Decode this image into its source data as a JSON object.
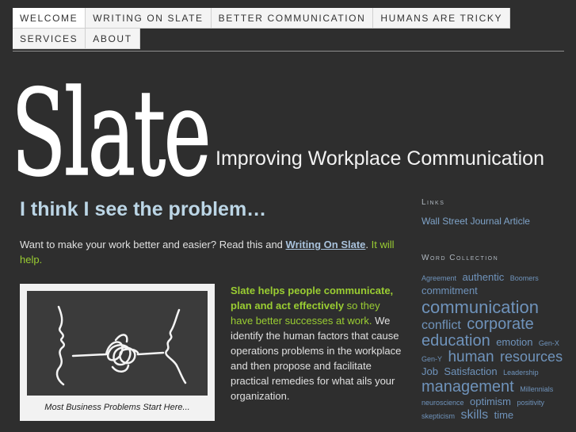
{
  "nav": {
    "items": [
      {
        "label": "WELCOME",
        "name": "nav-welcome"
      },
      {
        "label": "WRITING ON SLATE",
        "name": "nav-writing-on-slate"
      },
      {
        "label": "BETTER COMMUNICATION",
        "name": "nav-better-communication"
      },
      {
        "label": "HUMANS ARE TRICKY",
        "name": "nav-humans-are-tricky"
      },
      {
        "label": "SERVICES",
        "name": "nav-services"
      },
      {
        "label": "ABOUT",
        "name": "nav-about"
      }
    ],
    "active": "WELCOME"
  },
  "header": {
    "logo_text": "Slate",
    "tagline": "Improving Workplace Communication"
  },
  "main": {
    "title": "I think I see the problem…",
    "intro_before": "Want to make your work better and easier? Read this and ",
    "intro_link": "Writing On Slate",
    "intro_mid": ". ",
    "intro_after": "It will help.",
    "figure_caption": "Most Business Problems Start Here...",
    "body_bold": "Slate helps people communicate, plan and act effectively",
    "body_green": " so they have better successes at work.",
    "body_rest": " We identify the human factors that cause operations problems in the workplace and then propose and facilitate practical remedies for what ails your organization."
  },
  "sidebar": {
    "links_heading": "Links",
    "links": [
      "Wall Street Journal Article"
    ],
    "cloud_heading": "Word Collection",
    "tags": [
      {
        "text": "Agreement",
        "size": 9
      },
      {
        "text": "authentic",
        "size": 13
      },
      {
        "text": "Boomers",
        "size": 9
      },
      {
        "text": "commitment",
        "size": 13
      },
      {
        "text": "communication",
        "size": 22
      },
      {
        "text": "conflict",
        "size": 16
      },
      {
        "text": "corporate",
        "size": 20
      },
      {
        "text": "education",
        "size": 20
      },
      {
        "text": "emotion",
        "size": 13
      },
      {
        "text": "Gen-X",
        "size": 9
      },
      {
        "text": "Gen-Y",
        "size": 9
      },
      {
        "text": "human",
        "size": 19
      },
      {
        "text": "resources",
        "size": 18
      },
      {
        "text": "Job",
        "size": 13
      },
      {
        "text": "Satisfaction",
        "size": 13
      },
      {
        "text": "Leadership",
        "size": 9
      },
      {
        "text": "management",
        "size": 20
      },
      {
        "text": "Millennials",
        "size": 9
      },
      {
        "text": "neuroscience",
        "size": 9
      },
      {
        "text": "optimism",
        "size": 13
      },
      {
        "text": "positivity",
        "size": 9
      },
      {
        "text": "skepticism",
        "size": 9
      },
      {
        "text": "skills",
        "size": 16
      },
      {
        "text": "time",
        "size": 13
      }
    ]
  },
  "colors": {
    "background": "#2e2e2e",
    "accent_green": "#9acd32",
    "link_blue": "#7fa3c8",
    "title_blue": "#bcd6e6"
  }
}
